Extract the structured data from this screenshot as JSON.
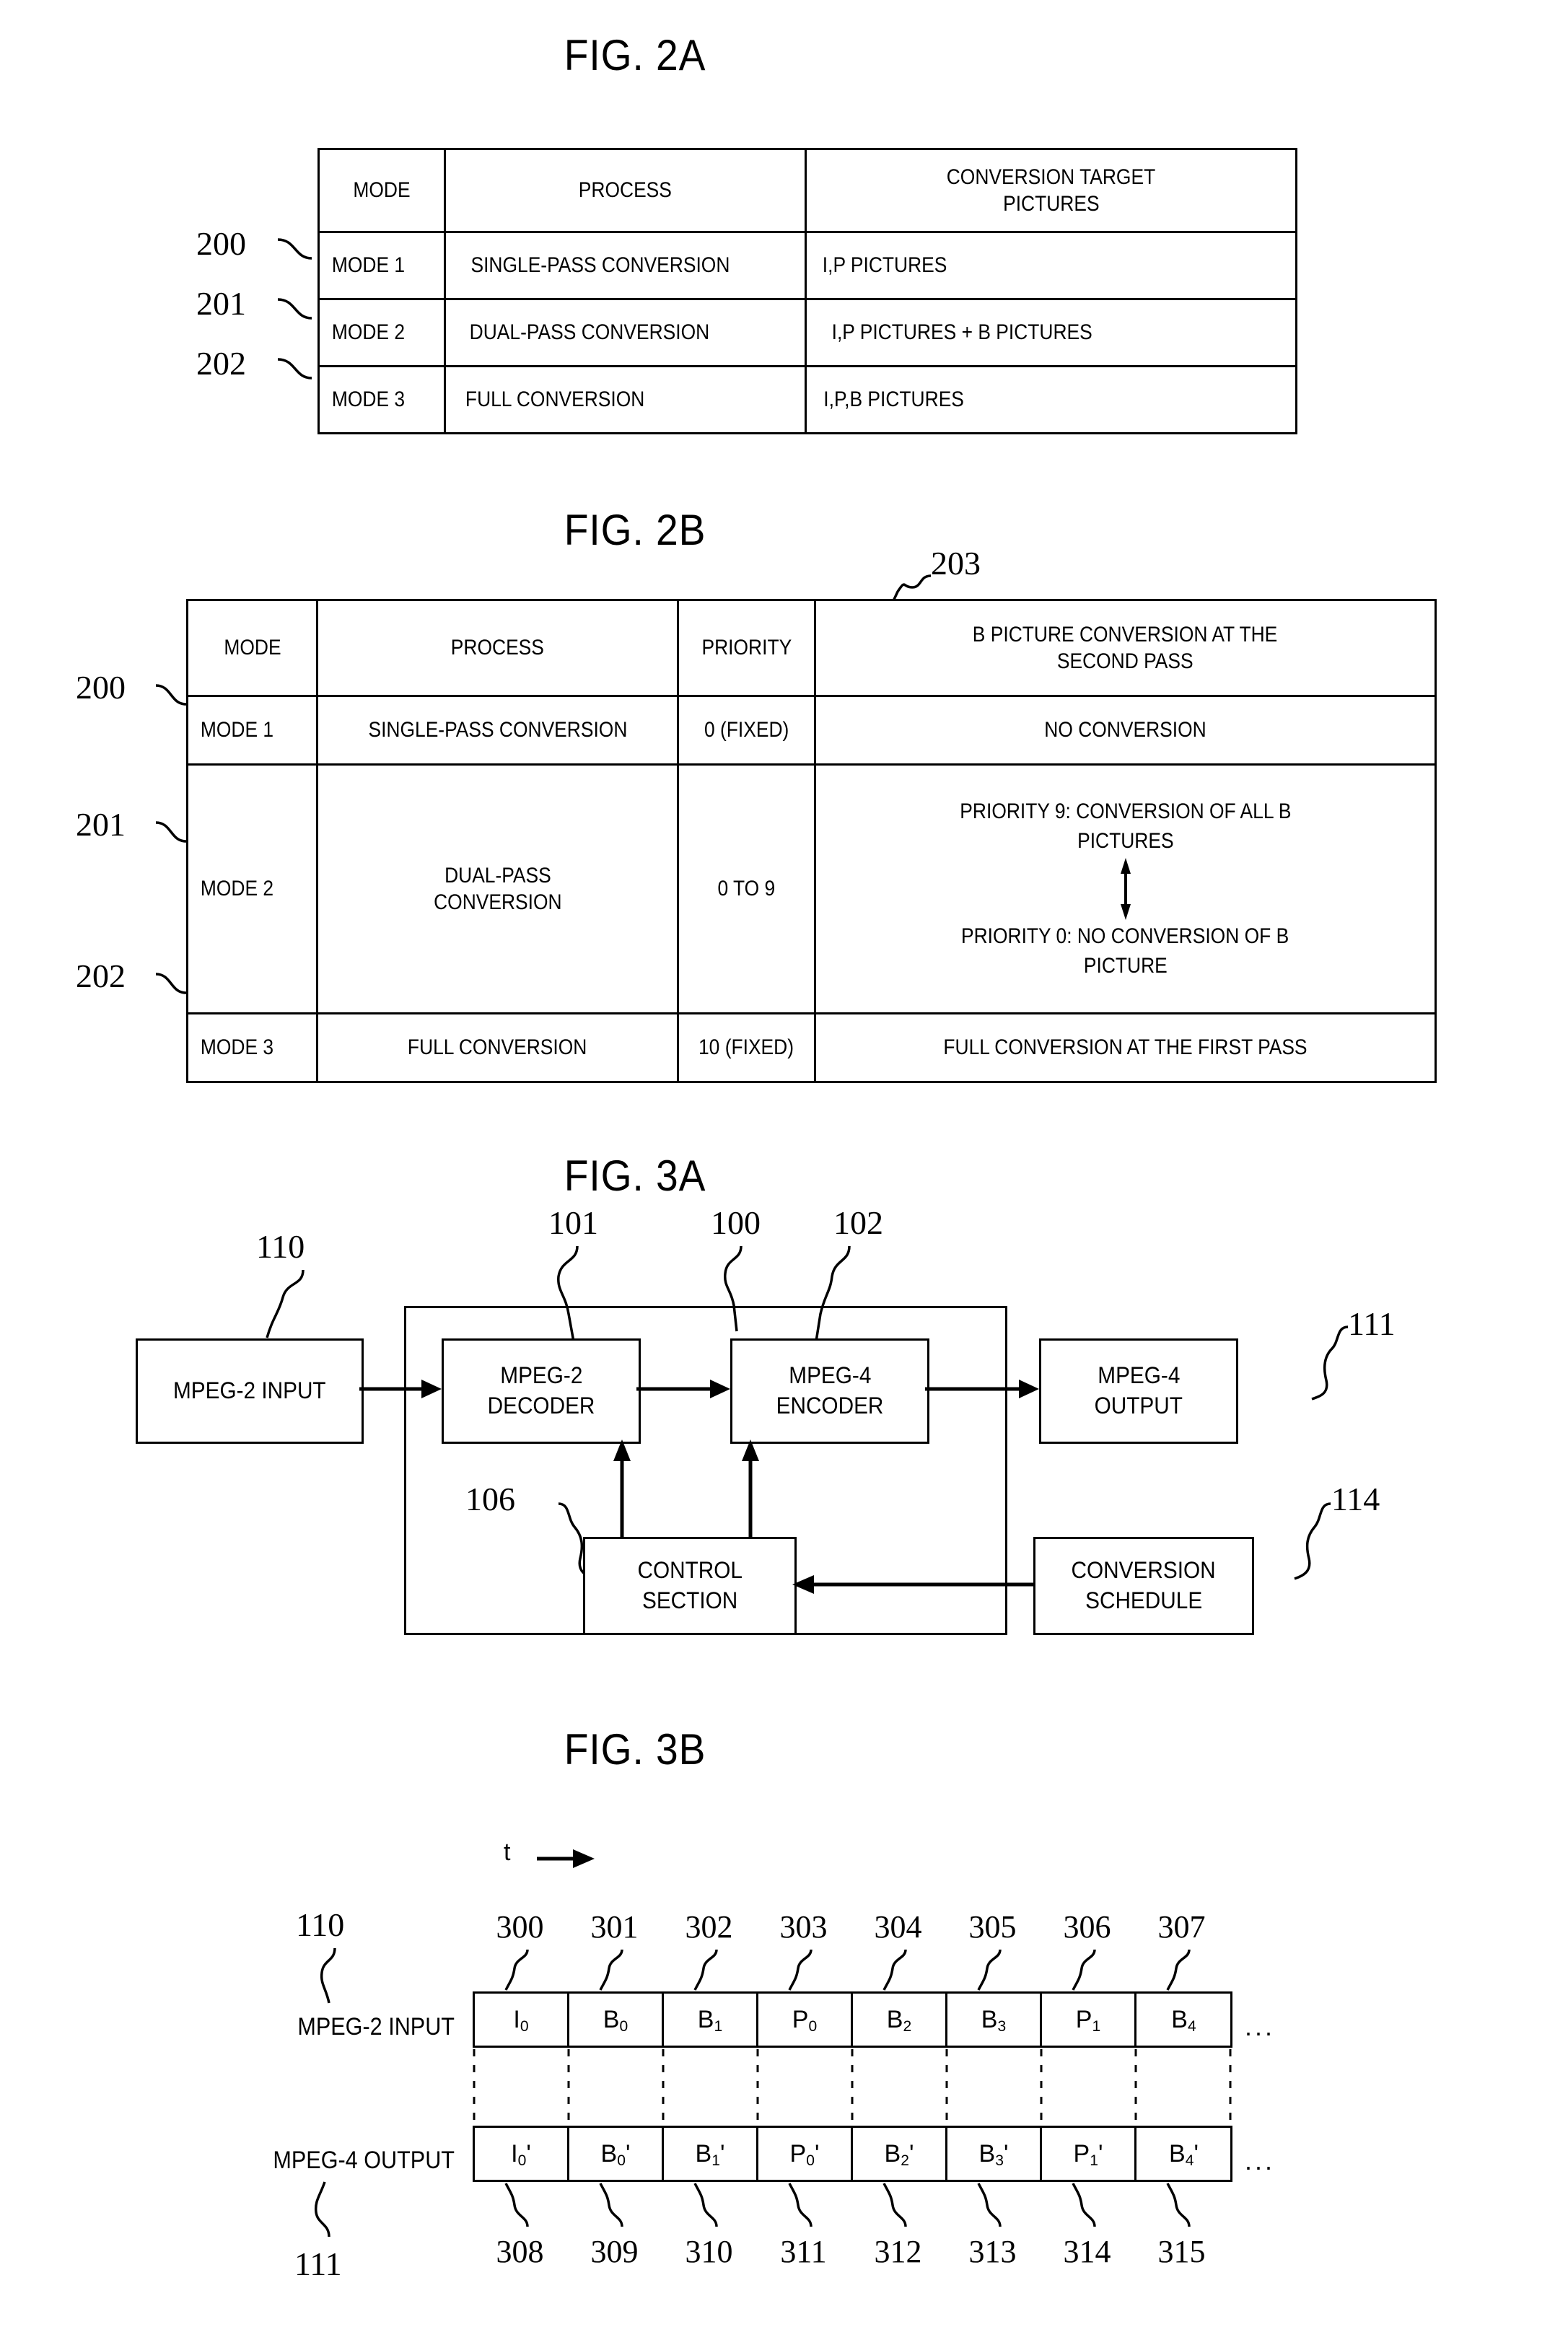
{
  "figures": {
    "fig2a": {
      "title": "FIG. 2A",
      "refs": [
        "200",
        "201",
        "202"
      ],
      "headers": [
        "MODE",
        "PROCESS",
        "CONVERSION TARGET PICTURES"
      ],
      "header_lines": [
        [
          "MODE"
        ],
        [
          "PROCESS"
        ],
        [
          "CONVERSION TARGET",
          "PICTURES"
        ]
      ],
      "rows": [
        {
          "mode": "MODE 1",
          "process": "SINGLE-PASS CONVERSION",
          "target": "I,P PICTURES"
        },
        {
          "mode": "MODE 2",
          "process": "DUAL-PASS CONVERSION",
          "target": "I,P PICTURES + B PICTURES"
        },
        {
          "mode": "MODE 3",
          "process": "FULL CONVERSION",
          "target": "I,P,B PICTURES"
        }
      ]
    },
    "fig2b": {
      "title": "FIG. 2B",
      "refs": [
        "200",
        "201",
        "202"
      ],
      "ref_priority": "203",
      "headers": [
        "MODE",
        "PROCESS",
        "PRIORITY",
        "B PICTURE CONVERSION AT THE SECOND PASS"
      ],
      "header_lines": [
        [
          "MODE"
        ],
        [
          "PROCESS"
        ],
        [
          "PRIORITY"
        ],
        [
          "B PICTURE CONVERSION AT THE",
          "SECOND PASS"
        ]
      ],
      "rows": [
        {
          "mode": "MODE 1",
          "process_lines": [
            "SINGLE-PASS CONVERSION"
          ],
          "priority": "0 (FIXED)",
          "bconv_lines": [
            "NO CONVERSION"
          ],
          "has_arrow": false
        },
        {
          "mode": "MODE 2",
          "process_lines": [
            "DUAL-PASS",
            "CONVERSION"
          ],
          "priority": "0 TO 9",
          "bconv_top_lines": [
            "PRIORITY 9: CONVERSION OF ALL B",
            "PICTURES"
          ],
          "bconv_bottom_lines": [
            "PRIORITY 0: NO CONVERSION OF B",
            "PICTURE"
          ],
          "has_arrow": true
        },
        {
          "mode": "MODE 3",
          "process_lines": [
            "FULL CONVERSION"
          ],
          "priority": "10 (FIXED)",
          "bconv_lines": [
            "FULL CONVERSION AT THE FIRST PASS"
          ],
          "has_arrow": false
        }
      ]
    },
    "fig3a": {
      "title": "FIG. 3A",
      "blocks": [
        {
          "ref": "110",
          "lines": [
            "MPEG-2 INPUT"
          ]
        },
        {
          "ref": "101",
          "lines": [
            "MPEG-2",
            "DECODER"
          ]
        },
        {
          "ref": "102",
          "lines": [
            "MPEG-4",
            "ENCODER"
          ]
        },
        {
          "ref": "111",
          "lines": [
            "MPEG-4",
            "OUTPUT"
          ]
        },
        {
          "ref": "106",
          "lines": [
            "CONTROL",
            "SECTION"
          ]
        },
        {
          "ref": "114",
          "lines": [
            "CONVERSION",
            "SCHEDULE"
          ]
        }
      ],
      "container_ref": "100"
    },
    "fig3b": {
      "title": "FIG. 3B",
      "time_axis_label": "t",
      "input_row": {
        "ref": "110",
        "label": "MPEG-2 INPUT",
        "cells": [
          {
            "base": "I",
            "sub": "0",
            "prime": ""
          },
          {
            "base": "B",
            "sub": "0",
            "prime": ""
          },
          {
            "base": "B",
            "sub": "1",
            "prime": ""
          },
          {
            "base": "P",
            "sub": "0",
            "prime": ""
          },
          {
            "base": "B",
            "sub": "2",
            "prime": ""
          },
          {
            "base": "B",
            "sub": "3",
            "prime": ""
          },
          {
            "base": "P",
            "sub": "1",
            "prime": ""
          },
          {
            "base": "B",
            "sub": "4",
            "prime": ""
          }
        ],
        "cell_refs": [
          "300",
          "301",
          "302",
          "303",
          "304",
          "305",
          "306",
          "307"
        ],
        "trailing": "..."
      },
      "output_row": {
        "ref": "111",
        "label": "MPEG-4 OUTPUT",
        "cells": [
          {
            "base": "I",
            "sub": "0",
            "prime": "'"
          },
          {
            "base": "B",
            "sub": "0",
            "prime": "'"
          },
          {
            "base": "B",
            "sub": "1",
            "prime": "'"
          },
          {
            "base": "P",
            "sub": "0",
            "prime": "'"
          },
          {
            "base": "B",
            "sub": "2",
            "prime": "'"
          },
          {
            "base": "B",
            "sub": "3",
            "prime": "'"
          },
          {
            "base": "P",
            "sub": "1",
            "prime": "'"
          },
          {
            "base": "B",
            "sub": "4",
            "prime": "'"
          }
        ],
        "cell_refs": [
          "308",
          "309",
          "310",
          "311",
          "312",
          "313",
          "314",
          "315"
        ],
        "trailing": "..."
      }
    }
  },
  "colors": {
    "ink": "#000000",
    "paper": "#ffffff"
  }
}
